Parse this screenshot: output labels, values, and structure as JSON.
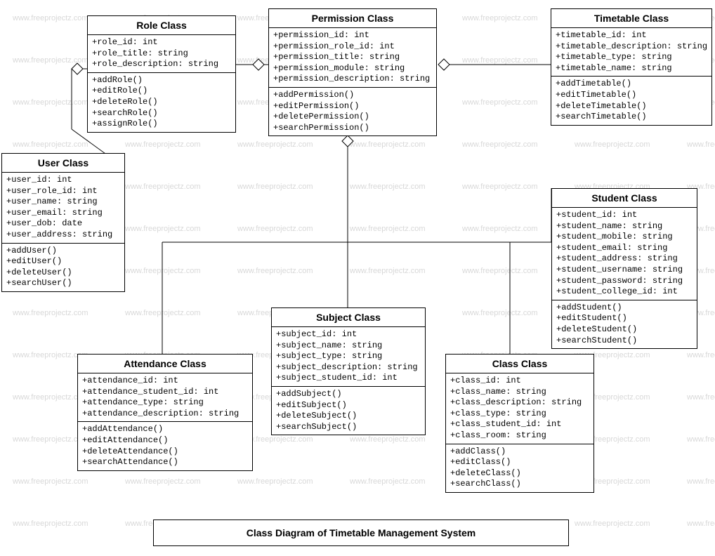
{
  "diagram_title": "Class Diagram of Timetable Management System",
  "watermark_text": "www.freeprojectz.com",
  "classes": {
    "role": {
      "title": "Role Class",
      "attrs": [
        "+role_id: int",
        "+role_title: string",
        "+role_description: string"
      ],
      "ops": [
        "+addRole()",
        "+editRole()",
        "+deleteRole()",
        "+searchRole()",
        "+assignRole()"
      ]
    },
    "permission": {
      "title": "Permission Class",
      "attrs": [
        "+permission_id: int",
        "+permission_role_id: int",
        "+permission_title: string",
        "+permission_module: string",
        "+permission_description: string"
      ],
      "ops": [
        "+addPermission()",
        "+editPermission()",
        "+deletePermission()",
        "+searchPermission()"
      ]
    },
    "timetable": {
      "title": "Timetable Class",
      "attrs": [
        "+timetable_id: int",
        "+timetable_description: string",
        "+timetable_type: string",
        "+timetable_name: string"
      ],
      "ops": [
        "+addTimetable()",
        "+editTimetable()",
        "+deleteTimetable()",
        "+searchTimetable()"
      ]
    },
    "user": {
      "title": "User Class",
      "attrs": [
        "+user_id: int",
        "+user_role_id: int",
        "+user_name: string",
        "+user_email: string",
        "+user_dob: date",
        "+user_address: string"
      ],
      "ops": [
        "+addUser()",
        "+editUser()",
        "+deleteUser()",
        "+searchUser()"
      ]
    },
    "student": {
      "title": "Student Class",
      "attrs": [
        "+student_id: int",
        "+student_name: string",
        "+student_mobile: string",
        "+student_email: string",
        "+student_address: string",
        "+student_username: string",
        "+student_password: string",
        "+student_college_id: int"
      ],
      "ops": [
        "+addStudent()",
        "+editStudent()",
        "+deleteStudent()",
        "+searchStudent()"
      ]
    },
    "subject": {
      "title": "Subject Class",
      "attrs": [
        "+subject_id: int",
        "+subject_name: string",
        "+subject_type: string",
        "+subject_description: string",
        "+subject_student_id: int"
      ],
      "ops": [
        "+addSubject()",
        "+editSubject()",
        "+deleteSubject()",
        "+searchSubject()"
      ]
    },
    "attendance": {
      "title": "Attendance Class",
      "attrs": [
        "+attendance_id: int",
        "+attendance_student_id: int",
        "+attendance_type: string",
        "+attendance_description: string"
      ],
      "ops": [
        "+addAttendance()",
        "+editAttendance()",
        "+deleteAttendance()",
        "+searchAttendance()"
      ]
    },
    "class": {
      "title": "Class Class",
      "attrs": [
        "+class_id: int",
        "+class_name: string",
        "+class_description: string",
        "+class_type: string",
        "+class_student_id: int",
        "+class_room: string"
      ],
      "ops": [
        "+addClass()",
        "+editClass()",
        "+deleteClass()",
        "+searchClass()"
      ]
    }
  }
}
